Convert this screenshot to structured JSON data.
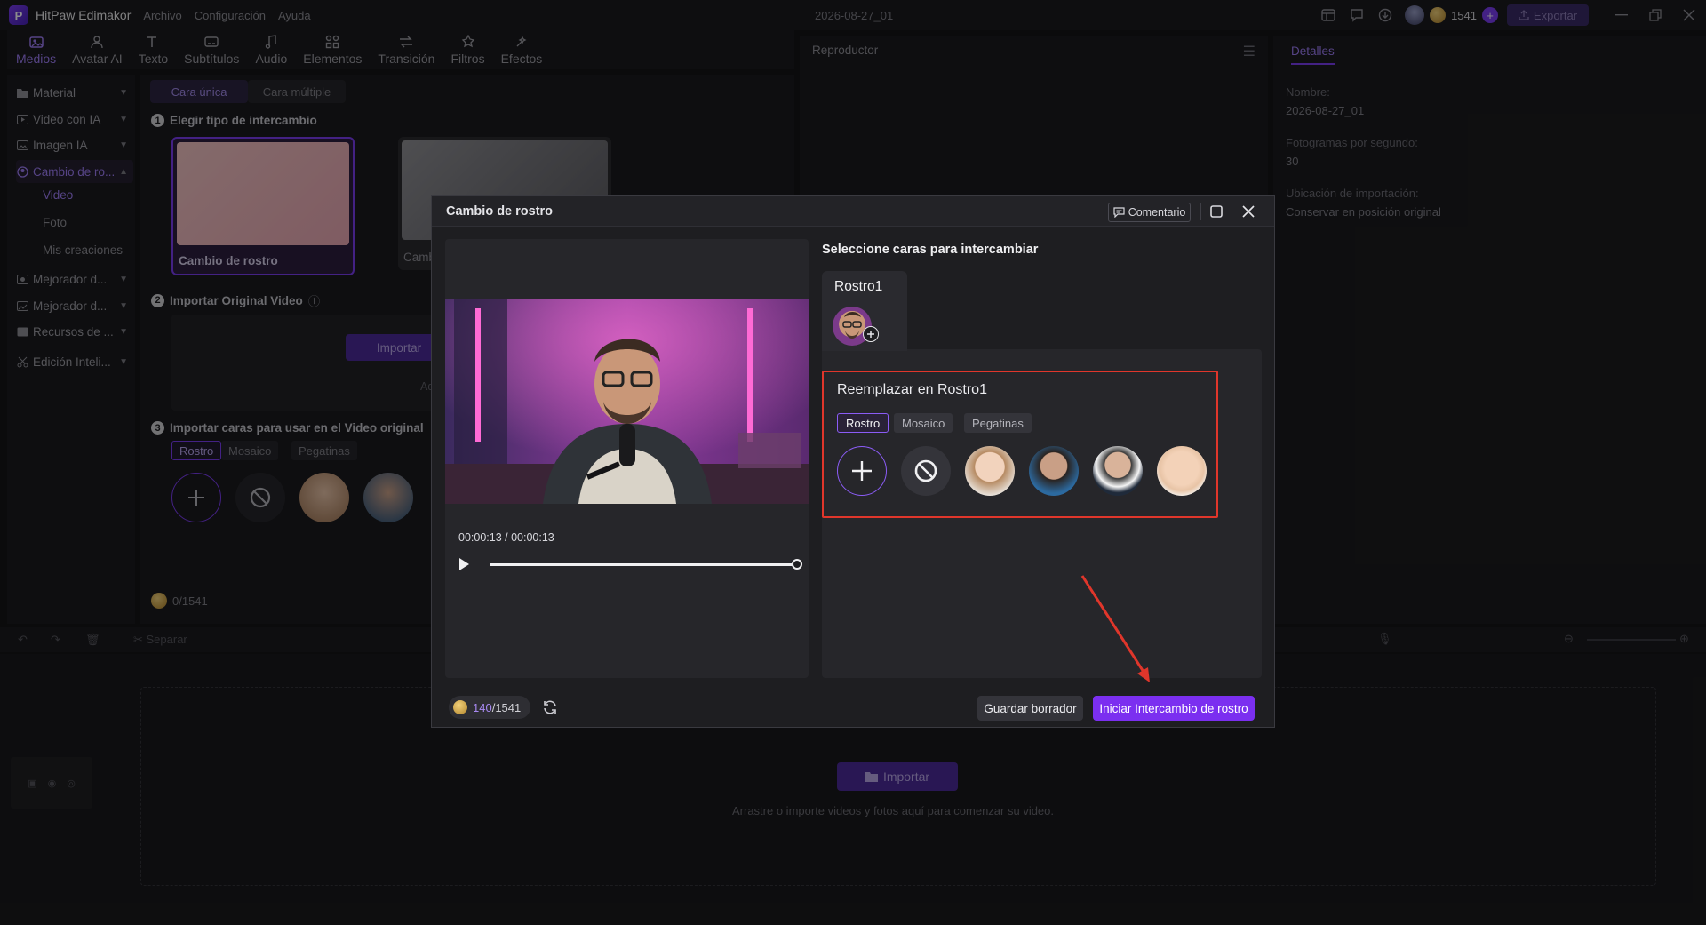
{
  "app": {
    "name": "HitPaw Edimakor",
    "menu": [
      "Archivo",
      "Configuración",
      "Ayuda"
    ],
    "project": "2026-08-27_01",
    "credits": "1541",
    "export_label": "Exportar"
  },
  "toolbar": {
    "tools": [
      {
        "label": "Medios",
        "icon": "media-icon"
      },
      {
        "label": "Avatar AI",
        "icon": "avatar-icon"
      },
      {
        "label": "Texto",
        "icon": "text-icon"
      },
      {
        "label": "Subtítulos",
        "icon": "subtitles-icon"
      },
      {
        "label": "Audio",
        "icon": "audio-icon"
      },
      {
        "label": "Elementos",
        "icon": "elements-icon"
      },
      {
        "label": "Transición",
        "icon": "transition-icon"
      },
      {
        "label": "Filtros",
        "icon": "filters-icon"
      },
      {
        "label": "Efectos",
        "icon": "effects-icon"
      }
    ]
  },
  "leftnav": {
    "items": [
      {
        "label": "Material"
      },
      {
        "label": "Video con IA"
      },
      {
        "label": "Imagen IA"
      },
      {
        "label": "Cambio de ro..."
      },
      {
        "label": "Mejorador d..."
      },
      {
        "label": "Mejorador d..."
      },
      {
        "label": "Recursos de ..."
      },
      {
        "label": "Edición Inteli..."
      }
    ],
    "subitems": [
      "Video",
      "Foto",
      "Mis creaciones"
    ]
  },
  "mid": {
    "seg_single": "Cara única",
    "seg_multi": "Cara múltiple",
    "step1": "Elegir tipo de intercambio",
    "card1_label": "Cambio de rostro",
    "card2_label": "Camb",
    "step2": "Importar Original Video",
    "import_label": "Importar",
    "admite": "Admite",
    "step3": "Importar caras para usar en el Video original",
    "chips": [
      "Rostro",
      "Mosaico",
      "Pegatinas"
    ],
    "credits": "0/1541"
  },
  "player": {
    "title": "Reproductor"
  },
  "details": {
    "tab": "Detalles",
    "name_label": "Nombre:",
    "name_value": "2026-08-27_01",
    "fps_label": "Fotogramas por segundo:",
    "fps_value": "30",
    "location_label": "Ubicación de importación:",
    "location_value": "Conservar en posición original"
  },
  "timeline": {
    "split_label": "Separar",
    "import_label": "Importar",
    "hint": "Arrastre o importe videos y fotos aquí para comenzar su video."
  },
  "modal": {
    "title": "Cambio de rostro",
    "comment_label": "Comentario",
    "time_current": "00:00:13",
    "time_sep": " / ",
    "time_total": "00:00:13",
    "progress": 1.0,
    "faces_title": "Seleccione caras para intercambiar",
    "face_tab_label": "Rostro1",
    "replace_title": "Reemplazar en Rostro1",
    "mode_chips": [
      "Rostro",
      "Mosaico",
      "Pegatinas"
    ],
    "credits_used": "140",
    "credits_total": "/1541",
    "save_label": "Guardar borrador",
    "start_label": "Iniciar Intercambio de rostro"
  },
  "colors": {
    "accent": "#7b2ff0",
    "highlight_box": "#e0362b",
    "arrow": "#e0362b"
  }
}
